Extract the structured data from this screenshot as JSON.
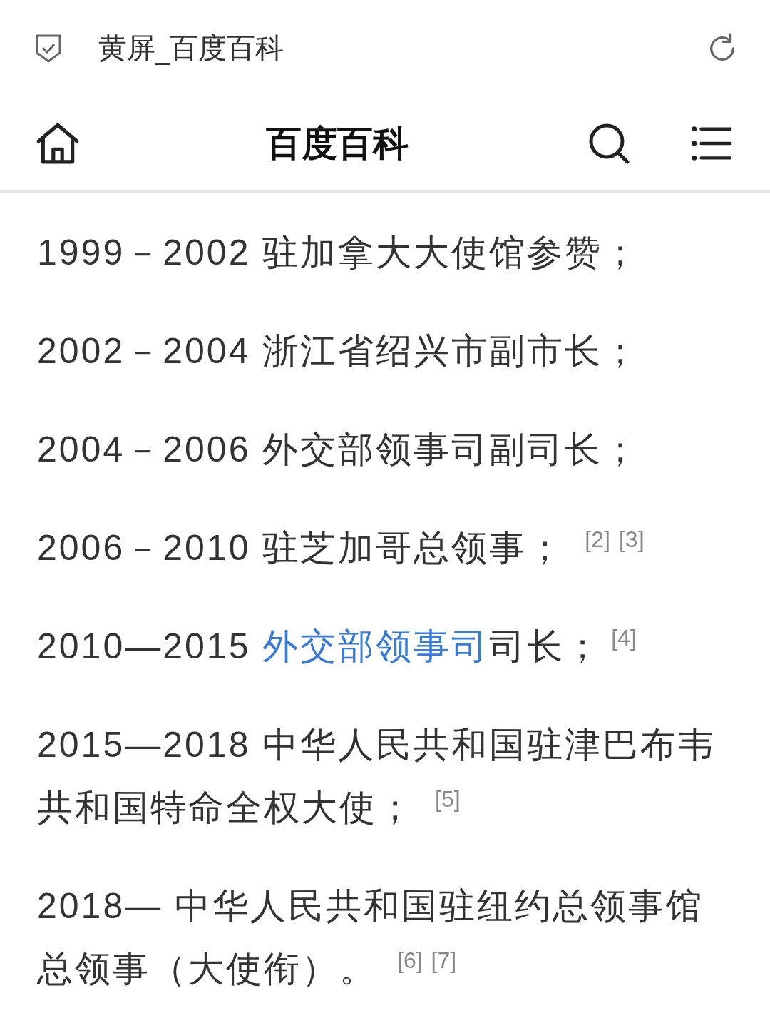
{
  "title_bar": {
    "title": "黄屏_百度百科"
  },
  "nav_bar": {
    "title": "百度百科"
  },
  "entries": [
    {
      "period": "1999－2002",
      "text": "驻加拿大大使馆参赞；"
    },
    {
      "period": "2002－2004",
      "text": "浙江省绍兴市副市长；"
    },
    {
      "period": "2004－2006",
      "text": "外交部领事司副司长；"
    },
    {
      "period": "2006－2010",
      "text": "驻芝加哥总领事；",
      "citations": [
        "[2]",
        "[3]"
      ]
    },
    {
      "period": "2010—2015",
      "link": "外交部领事司",
      "text": "司长；",
      "citations": [
        "[4]"
      ]
    },
    {
      "period": "2015—2018",
      "text": "中华人民共和国驻津巴布韦共和国特命全权大使；",
      "citations": [
        "[5]"
      ]
    },
    {
      "period": "2018—",
      "text": "中华人民共和国驻纽约总领事馆总领事（大使衔）。",
      "citations": [
        "[6]",
        "[7]"
      ]
    }
  ]
}
